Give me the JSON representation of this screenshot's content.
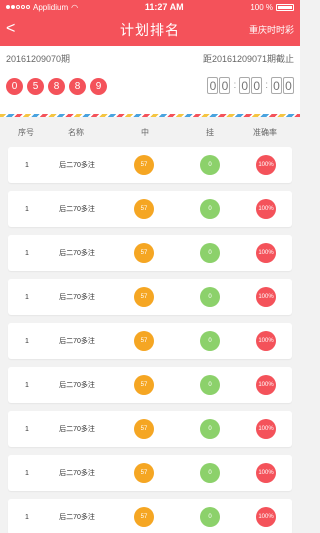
{
  "status_bar": {
    "carrier": "Applidium",
    "time": "11:27 AM",
    "battery": "100 %"
  },
  "nav": {
    "title": "计划排名",
    "right_label": "重庆时时彩",
    "back_icon": "chevron-left-icon"
  },
  "draw": {
    "current_period": "20161209070期",
    "next_period_text": "距20161209071期截止",
    "numbers": [
      "0",
      "5",
      "8",
      "8",
      "9"
    ],
    "countdown": [
      "0",
      "0",
      "0",
      "0",
      "0",
      "0"
    ]
  },
  "table": {
    "headers": {
      "seq": "序号",
      "name": "名称",
      "hit": "中",
      "miss": "挂",
      "rate": "准确率"
    },
    "rows": [
      {
        "seq": "1",
        "name": "后二70多注",
        "hit": "57",
        "miss": "0",
        "rate": "100%"
      },
      {
        "seq": "1",
        "name": "后二70多注",
        "hit": "57",
        "miss": "0",
        "rate": "100%"
      },
      {
        "seq": "1",
        "name": "后二70多注",
        "hit": "57",
        "miss": "0",
        "rate": "100%"
      },
      {
        "seq": "1",
        "name": "后二70多注",
        "hit": "57",
        "miss": "0",
        "rate": "100%"
      },
      {
        "seq": "1",
        "name": "后二70多注",
        "hit": "57",
        "miss": "0",
        "rate": "100%"
      },
      {
        "seq": "1",
        "name": "后二70多注",
        "hit": "57",
        "miss": "0",
        "rate": "100%"
      },
      {
        "seq": "1",
        "name": "后二70多注",
        "hit": "57",
        "miss": "0",
        "rate": "100%"
      },
      {
        "seq": "1",
        "name": "后二70多注",
        "hit": "57",
        "miss": "0",
        "rate": "100%"
      },
      {
        "seq": "1",
        "name": "后二70多注",
        "hit": "57",
        "miss": "0",
        "rate": "100%"
      }
    ]
  },
  "colors": {
    "primary": "#f4525a",
    "hit": "#f5a623",
    "miss": "#8cd16b"
  }
}
